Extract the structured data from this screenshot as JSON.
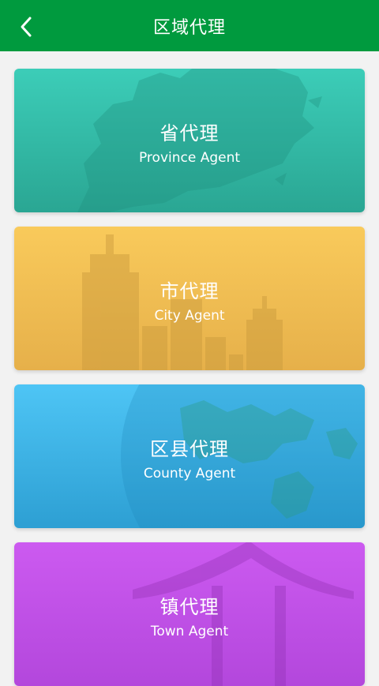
{
  "header": {
    "title": "区域代理",
    "background": "#009a3e"
  },
  "cards": [
    {
      "title_cn": "省代理",
      "title_en": "Province Agent",
      "color": "#33bfa8"
    },
    {
      "title_cn": "市代理",
      "title_en": "City Agent",
      "color": "#f2c154"
    },
    {
      "title_cn": "区县代理",
      "title_en": "County Agent",
      "color": "#3fb4e6"
    },
    {
      "title_cn": "镇代理",
      "title_en": "Town Agent",
      "color": "#c450ea"
    }
  ]
}
